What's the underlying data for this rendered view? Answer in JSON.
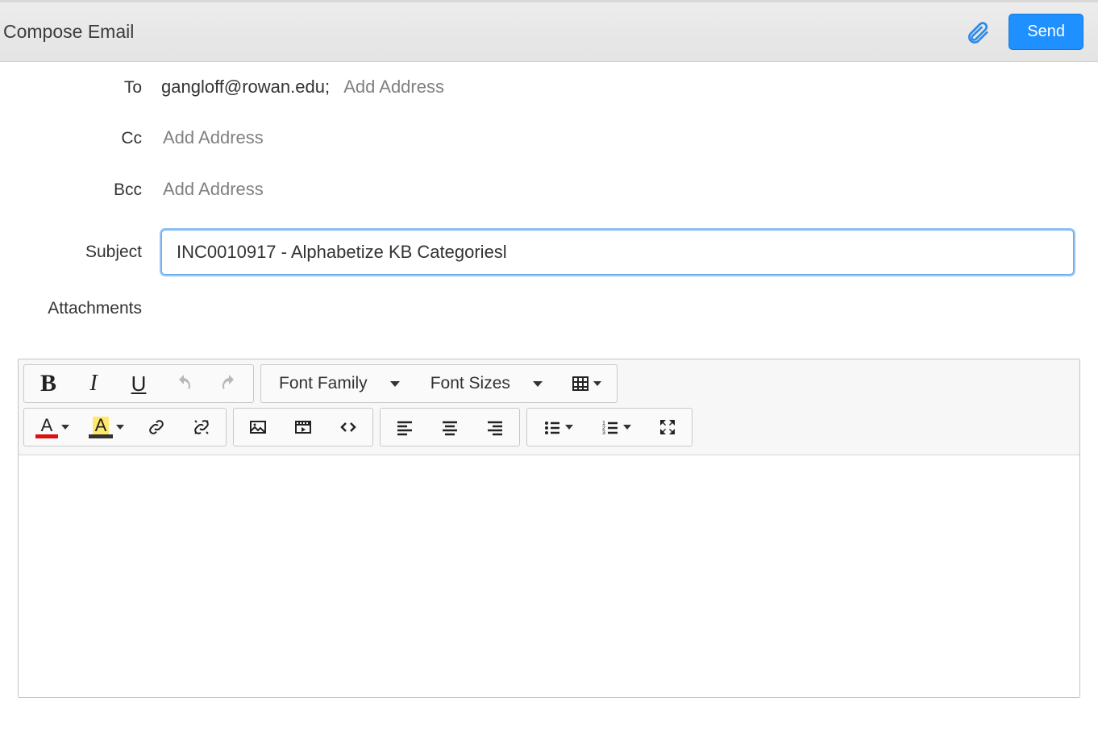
{
  "header": {
    "title": "Compose Email",
    "send_label": "Send"
  },
  "fields": {
    "to_label": "To",
    "to_value": "gangloff@rowan.edu;",
    "to_placeholder": "Add Address",
    "cc_label": "Cc",
    "cc_placeholder": "Add Address",
    "bcc_label": "Bcc",
    "bcc_placeholder": "Add Address",
    "subject_label": "Subject",
    "subject_value": "INC0010917 - Alphabetize KB Categoriesl",
    "attachments_label": "Attachments"
  },
  "editor": {
    "font_family_label": "Font Family",
    "font_sizes_label": "Font Sizes",
    "body": ""
  }
}
